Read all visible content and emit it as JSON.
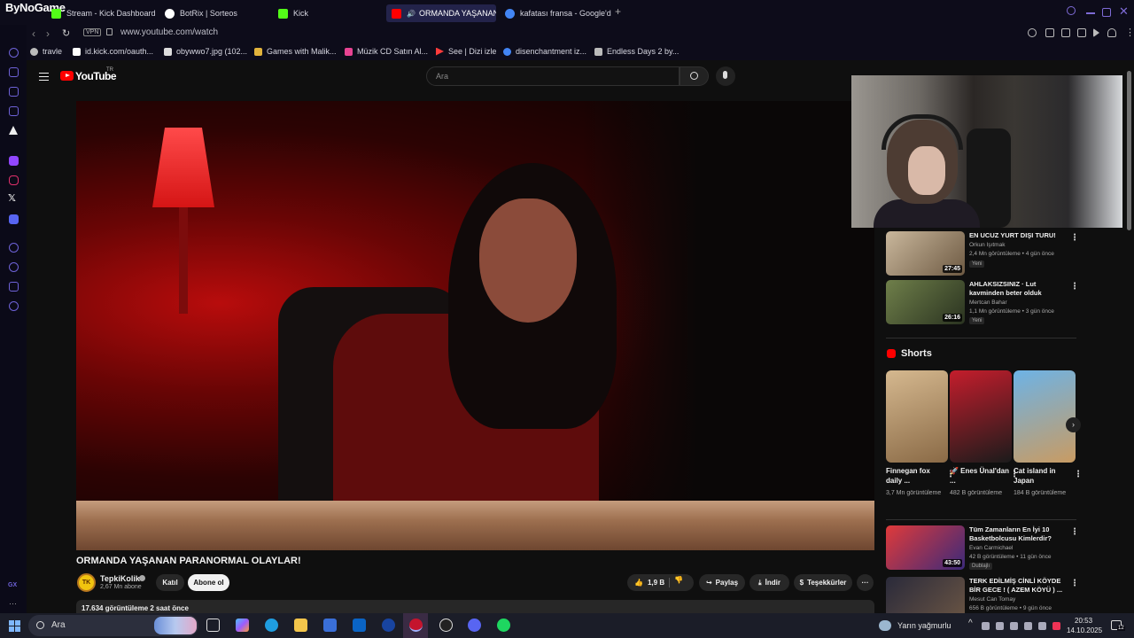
{
  "browser": {
    "corner_logo": "ByNoGame",
    "tabs": [
      {
        "label": "Stream - Kick Dashboard",
        "color": "#53fc18"
      },
      {
        "label": "BotRix | Sorteos",
        "color": "#ffffff"
      },
      {
        "label": "Kick",
        "color": "#53fc18"
      },
      {
        "label": "ORMANDA YAŞANAN",
        "color": "#ff0000",
        "active": true
      },
      {
        "label": "kafatası fransa - Google'd",
        "color": "#4285f4"
      }
    ],
    "vpn_label": "VPN",
    "url": "www.youtube.com/watch",
    "bookmarks": [
      {
        "label": "travle",
        "color": "#bbbbbb"
      },
      {
        "label": "id.kick.com/oauth...",
        "color": "#ffffff"
      },
      {
        "label": "obywwo7.jpg (102...",
        "color": "#dddddd"
      },
      {
        "label": "Games with Malik...",
        "color": "#e2b33c"
      },
      {
        "label": "Müzik CD Satın Al...",
        "color": "#e84393"
      },
      {
        "label": "See | Dizi izle",
        "color": "#ff3b3b"
      },
      {
        "label": "disenchantment iz...",
        "color": "#4285f4"
      },
      {
        "label": "Endless Days 2 by...",
        "color": "#bbbbbb"
      }
    ]
  },
  "youtube": {
    "logo_text": "YouTube",
    "country_code": "TR",
    "search_placeholder": "Ara",
    "video_title": "ORMANDA YAŞANAN PARANORMAL OLAYLAR!",
    "channel": {
      "name": "TepkiKolik",
      "avatar_text": "TK",
      "subscribers": "2,67 Mn abone",
      "join_label": "Katıl",
      "subscribe_label": "Abone ol"
    },
    "actions": {
      "likes": "1,9 B",
      "share": "Paylaş",
      "download": "İndir",
      "thanks": "Teşekkürler",
      "more": "···"
    },
    "description_stats": "17.634 görüntüleme  2 saat önce",
    "recommendations": [
      {
        "title": "EN UCUZ YURT DIŞI TURU!",
        "channel": "Orkun Işıtmak",
        "meta": "2,4 Mn görüntüleme • 4 gün önce",
        "badge": "Yeni",
        "duration": "27:45",
        "colors": [
          "#c9b79c",
          "#6e5a43"
        ]
      },
      {
        "title": "AHLAKSIZSINIZ · Lut kavminden beter olduk",
        "channel": "Mertcan Bahar",
        "meta": "1,1 Mn görüntüleme • 3 gün önce",
        "badge": "Yeni",
        "duration": "26:16",
        "colors": [
          "#6f7f4a",
          "#2a3320"
        ]
      }
    ],
    "shorts_label": "Shorts",
    "shorts": [
      {
        "title": "Finnegan fox daily ...",
        "views": "3,7 Mn görüntüleme",
        "colors": [
          "#d5b88f",
          "#8a6a46"
        ]
      },
      {
        "title": "🚀 Enes Ünal'dan ...",
        "views": "482 B görüntüleme",
        "colors": [
          "#c41d2c",
          "#1b1b1b"
        ]
      },
      {
        "title": "Cat island in Japan",
        "views": "184 B görüntüleme",
        "colors": [
          "#6db3e6",
          "#c99b62"
        ]
      }
    ],
    "more_recs": [
      {
        "title": "Tüm Zamanların En İyi 10 Basketbolcusu Kimlerdir?",
        "channel": "Evan Carmichael",
        "meta": "42 B görüntüleme • 11 gün önce",
        "badge": "Dublajlı",
        "duration": "43:50",
        "colors": [
          "#e03a3a",
          "#3b2a7a"
        ]
      },
      {
        "title": "TERK EDİLMİŞ CİNLİ KÖYDE BİR GECE ! ( AZEM KÖYÜ ) ...",
        "channel": "Mesut Can Tomay",
        "meta": "656 B görüntüleme • 9 gün önce",
        "badge": "",
        "duration": "",
        "colors": [
          "#2a2a3a",
          "#6a5544"
        ]
      }
    ]
  },
  "taskbar": {
    "search_label": "Ara",
    "weather": "Yarın yağmurlu",
    "time": "20:53",
    "date": "14.10.2025",
    "notif_count": "12"
  }
}
